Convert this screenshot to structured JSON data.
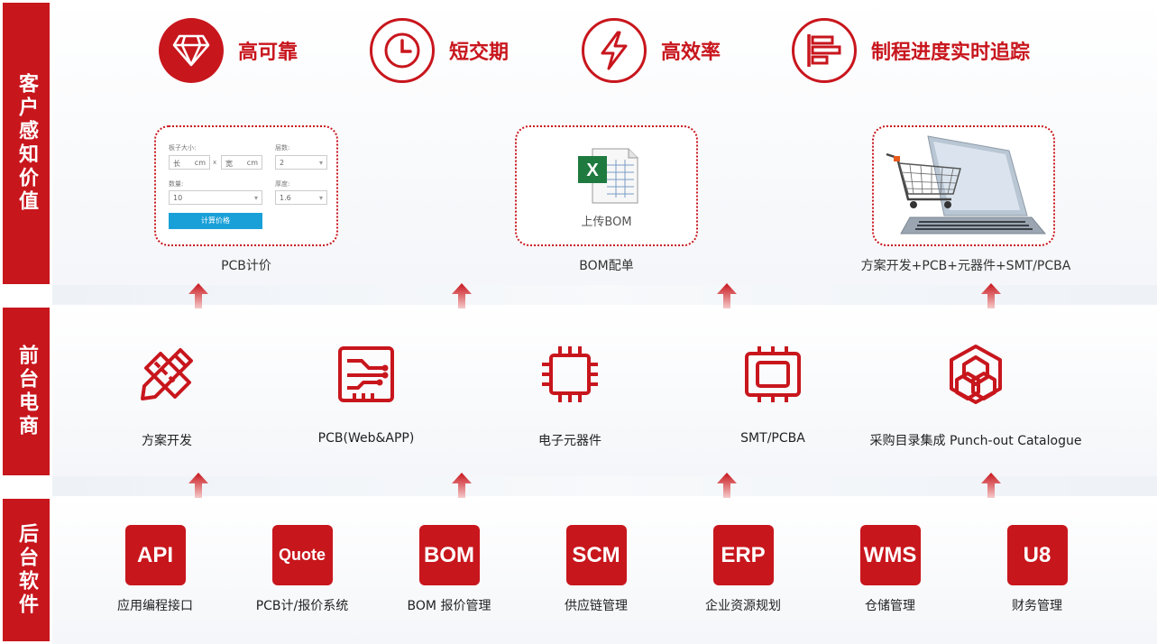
{
  "bands": {
    "customer": "客户感知价值",
    "frontend": "前台电商",
    "backend": "后台软件"
  },
  "values": [
    {
      "label": "高可靠",
      "icon": "diamond-icon"
    },
    {
      "label": "短交期",
      "icon": "clock-icon"
    },
    {
      "label": "高效率",
      "icon": "lightning-icon"
    },
    {
      "label": "制程进度实时追踪",
      "icon": "progress-bars-icon"
    }
  ],
  "cards": {
    "pcb": {
      "caption": "PCB计价",
      "size_label": "板子大小:",
      "layers_label": "层数:",
      "qty_label": "数量:",
      "thickness_label": "厚度:",
      "len_ph": "长",
      "wid_ph": "宽",
      "unit": "cm",
      "times": "x",
      "layers_value": "2",
      "qty_value": "10",
      "thickness_value": "1.6",
      "button": "计算价格"
    },
    "bom": {
      "caption": "BOM配单",
      "upload": "上传BOM"
    },
    "solution": {
      "caption": "方案开发+PCB+元器件+SMT/PCBA"
    }
  },
  "frontend": [
    {
      "label": "方案开发",
      "icon": "ruler-pencil-icon"
    },
    {
      "label": "PCB(Web&APP)",
      "icon": "circuit-board-icon"
    },
    {
      "label": "电子元器件",
      "icon": "chip-icon"
    },
    {
      "label": "SMT/PCBA",
      "icon": "smt-module-icon"
    },
    {
      "label": "采购目录集成 Punch-out Catalogue",
      "icon": "hexagon-network-icon"
    }
  ],
  "backend": [
    {
      "code": "API",
      "label": "应用编程接口"
    },
    {
      "code": "Quote",
      "label": "PCB计/报价系统"
    },
    {
      "code": "BOM",
      "label": "BOM 报价管理"
    },
    {
      "code": "SCM",
      "label": "供应链管理"
    },
    {
      "code": "ERP",
      "label": "企业资源规划"
    },
    {
      "code": "WMS",
      "label": "仓储管理"
    },
    {
      "code": "U8",
      "label": "财务管理"
    }
  ],
  "colors": {
    "accent": "#c8161d",
    "button": "#1aa0d8"
  }
}
